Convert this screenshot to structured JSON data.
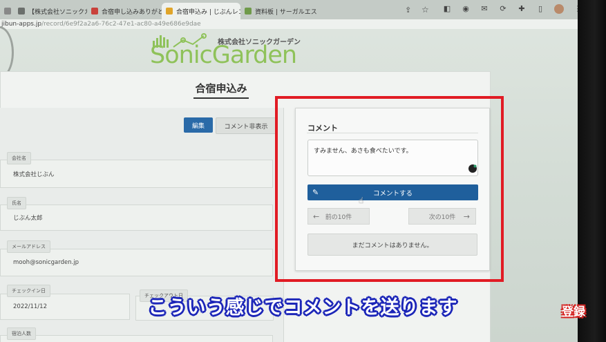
{
  "browser": {
    "tabs": [
      {
        "label": "【株式会社ソニックガー",
        "favicon_color": "#6b6f6c"
      },
      {
        "label": "合宿申し込みありがと",
        "favicon_color": "#c9413b"
      },
      {
        "label": "合宿申込み | じぶんレコ",
        "favicon_color": "#e0a52a"
      },
      {
        "label": "資料板 | サーガルエス",
        "favicon_color": "#6f9a4a"
      }
    ],
    "url_host": "jibun-apps.jp",
    "url_path": "/record/6e9f2a2a6-76c2-47e1-ac80-a49e686e9dae"
  },
  "logo": {
    "company_name": "株式会社ソニックガーデン",
    "wordmark": "SonicGarden"
  },
  "page": {
    "title": "合宿申込み",
    "edit_label": "編集",
    "hide_comments_label": "コメント非表示"
  },
  "form": {
    "company_label": "会社名",
    "company_value": "株式会社じぶん",
    "name_label": "氏名",
    "name_value": "じぶん太郎",
    "email_label": "メールアドレス",
    "email_value": "mooh@sonicgarden.jp",
    "checkin_label": "チェックイン日",
    "checkin_value": "2022/11/12",
    "checkout_label": "チェックアウト日",
    "guests_label": "宿泊人数"
  },
  "comments": {
    "heading": "コメント",
    "draft_text": "すみません、あさも食べたいです。",
    "submit_label": "コメントする",
    "prev_label": "前の10件",
    "next_label": "次の10件",
    "empty_message": "まだコメントはありません。",
    "accent_color": "#1f5f9c"
  },
  "overlay": {
    "subtitle": "こういう感じでコメントを送ります",
    "subscribe_badge": "登録",
    "highlight_color": "#e11b24"
  }
}
